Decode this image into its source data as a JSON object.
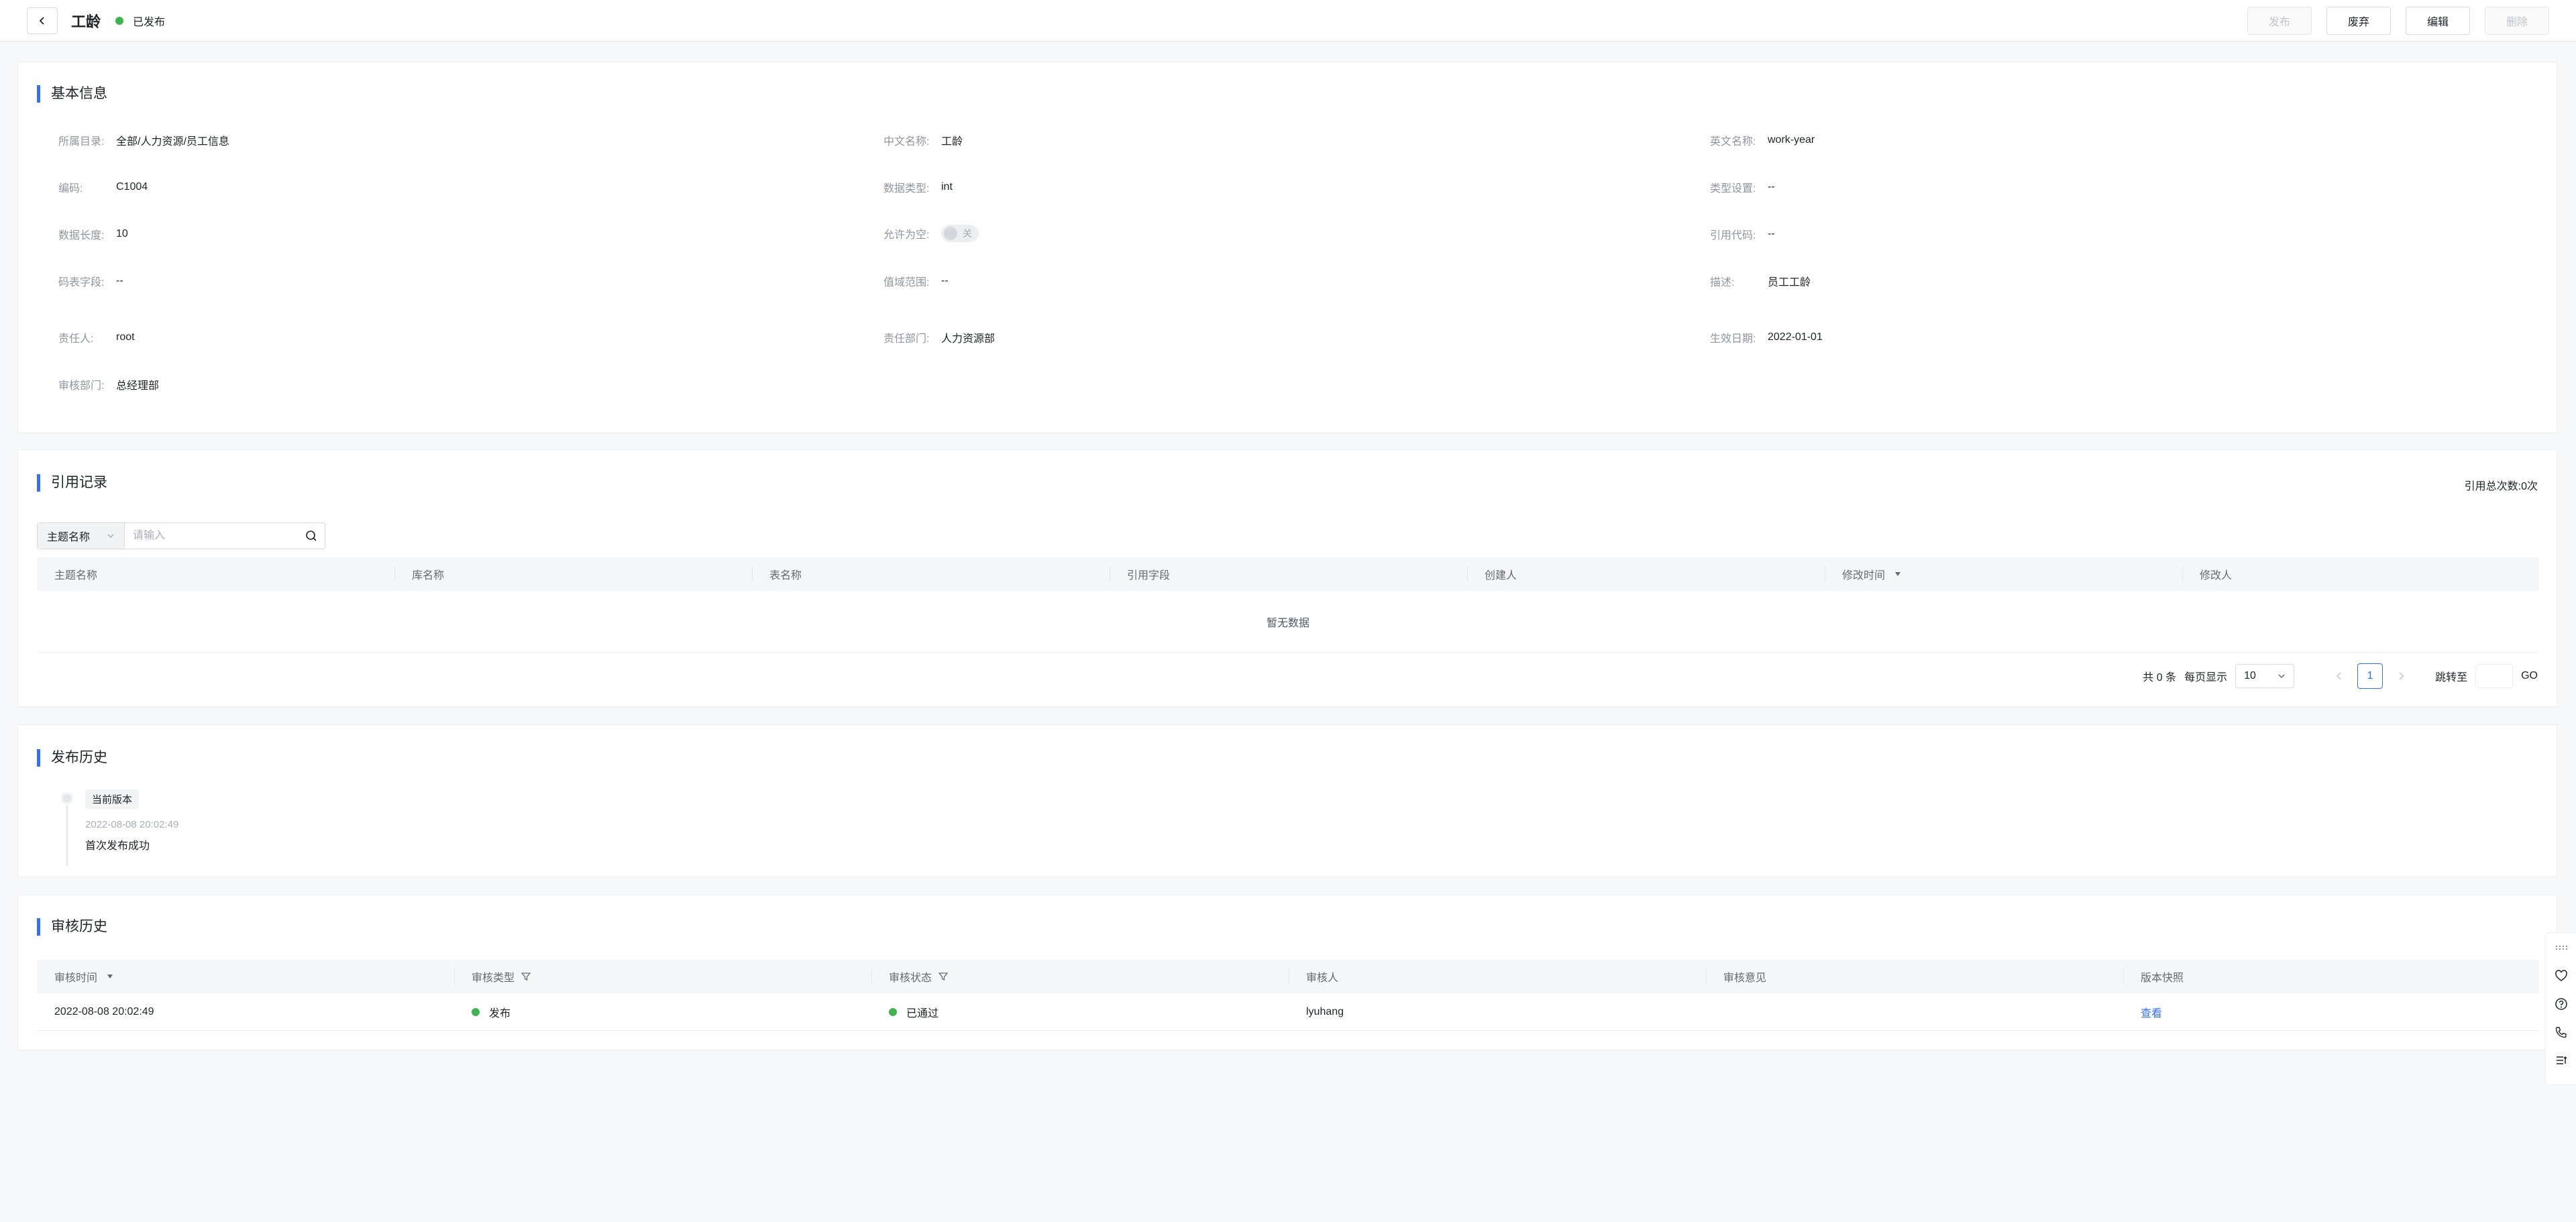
{
  "header": {
    "title": "工龄",
    "status": "已发布",
    "buttons": {
      "publish": "发布",
      "abandon": "废弃",
      "edit": "编辑",
      "delete": "删除"
    }
  },
  "basic_info": {
    "title": "基本信息",
    "fields": [
      {
        "label": "所属目录:",
        "value": "全部/人力资源/员工信息"
      },
      {
        "label": "中文名称:",
        "value": "工龄"
      },
      {
        "label": "英文名称:",
        "value": "work-year"
      },
      {
        "label": "编码:",
        "value": "C1004"
      },
      {
        "label": "数据类型:",
        "value": "int"
      },
      {
        "label": "类型设置:",
        "value": "--"
      },
      {
        "label": "数据长度:",
        "value": "10"
      },
      {
        "label": "允许为空:",
        "value": "关"
      },
      {
        "label": "引用代码:",
        "value": "--"
      },
      {
        "label": "码表字段:",
        "value": "--"
      },
      {
        "label": "值域范围:",
        "value": "--"
      },
      {
        "label": "描述:",
        "value": "员工工龄"
      },
      {
        "label": "责任人:",
        "value": "root"
      },
      {
        "label": "责任部门:",
        "value": "人力资源部"
      },
      {
        "label": "生效日期:",
        "value": "2022-01-01"
      },
      {
        "label": "审核部门:",
        "value": "总经理部"
      }
    ]
  },
  "references": {
    "title": "引用记录",
    "total_label": "引用总次数:",
    "total_value": "0次",
    "search": {
      "select_value": "主题名称",
      "placeholder": "请输入"
    },
    "columns": [
      "主题名称",
      "库名称",
      "表名称",
      "引用字段",
      "创建人",
      "修改时间",
      "修改人"
    ],
    "empty_text": "暂无数据",
    "pagination": {
      "total_text": "共 0 条",
      "per_page_label": "每页显示",
      "per_page_value": "10",
      "current_page": "1",
      "jump_label": "跳转至",
      "go_label": "GO"
    }
  },
  "publish_history": {
    "title": "发布历史",
    "entries": [
      {
        "tag": "当前版本",
        "time": "2022-08-08 20:02:49",
        "description": "首次发布成功"
      }
    ]
  },
  "audit_history": {
    "title": "审核历史",
    "columns": [
      "审核时间",
      "审核类型",
      "审核状态",
      "审核人",
      "审核意见",
      "版本快照"
    ],
    "rows": [
      {
        "time": "2022-08-08 20:02:49",
        "type": "发布",
        "status": "已通过",
        "auditor": "lyuhang",
        "opinion": "",
        "snapshot": "查看"
      }
    ]
  },
  "colors": {
    "accent": "#3370ff",
    "success": "#3fb550"
  }
}
